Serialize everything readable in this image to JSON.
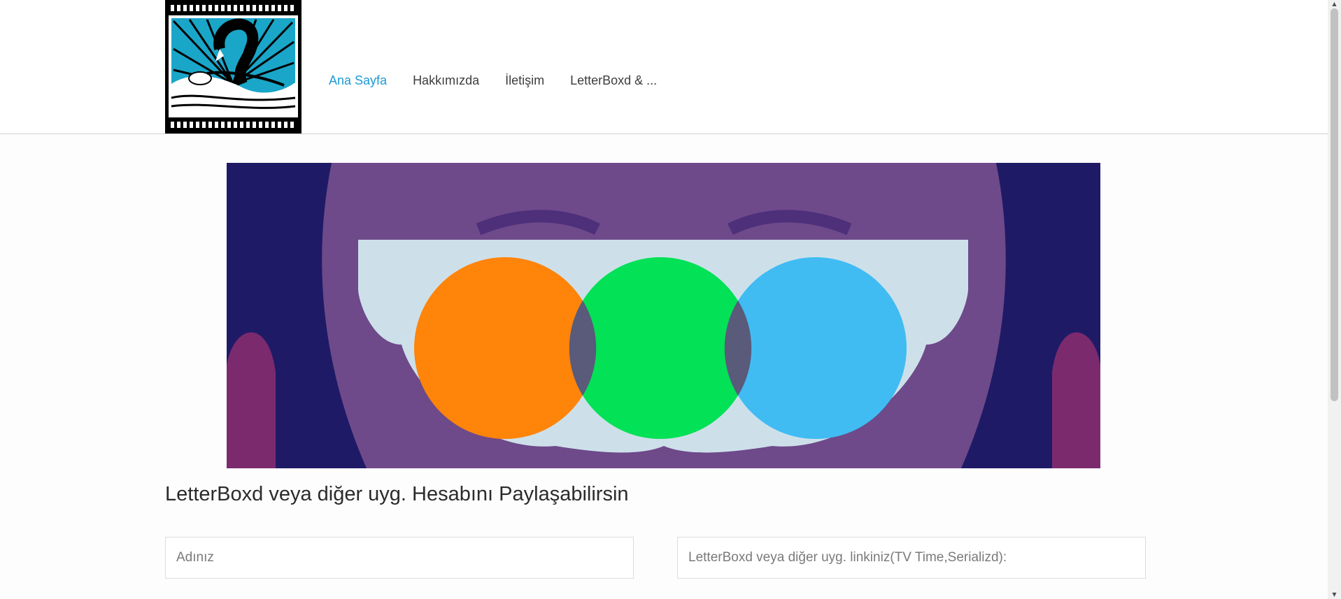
{
  "nav": {
    "items": [
      {
        "label": "Ana Sayfa",
        "active": true
      },
      {
        "label": "Hakkımızda",
        "active": false
      },
      {
        "label": "İletişim",
        "active": false
      },
      {
        "label": "LetterBoxd & ...",
        "active": false
      }
    ]
  },
  "hero": {
    "circle_colors": [
      "#ff840a",
      "#03e156",
      "#40bcf3"
    ]
  },
  "form": {
    "title": "LetterBoxd veya diğer uyg. Hesabını Paylaşabilirsin",
    "name_placeholder": "Adınız",
    "link_placeholder": "LetterBoxd veya diğer uyg. linkiniz(TV Time,Serializd):"
  },
  "colors": {
    "accent": "#1e9ad6",
    "hero_background": "#2e1f63",
    "logo_accent": "#29b6d6"
  }
}
